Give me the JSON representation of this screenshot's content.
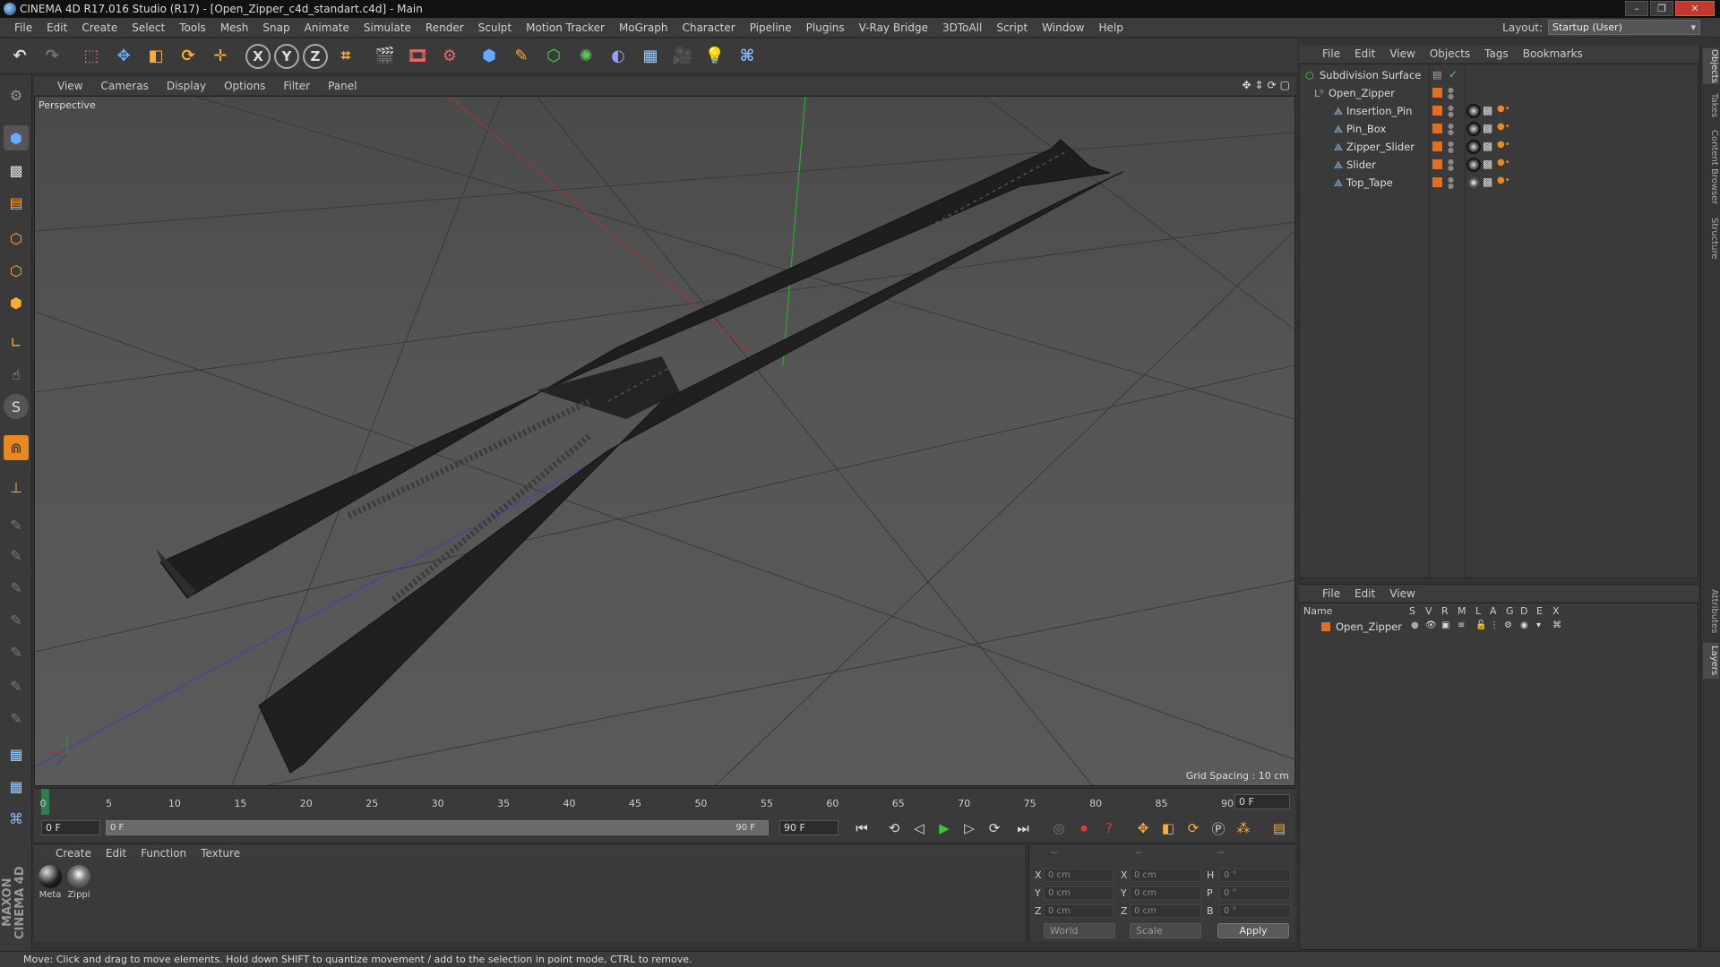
{
  "window": {
    "title": "CINEMA 4D R17.016 Studio (R17) - [Open_Zipper_c4d_standart.c4d] - Main"
  },
  "menu": [
    "File",
    "Edit",
    "Create",
    "Select",
    "Tools",
    "Mesh",
    "Snap",
    "Animate",
    "Simulate",
    "Render",
    "Sculpt",
    "Motion Tracker",
    "MoGraph",
    "Character",
    "Pipeline",
    "Plugins",
    "V-Ray Bridge",
    "3DToAll",
    "Script",
    "Window",
    "Help"
  ],
  "layout": {
    "label": "Layout:",
    "value": "Startup (User)"
  },
  "viewport": {
    "menu": [
      "View",
      "Cameras",
      "Display",
      "Options",
      "Filter",
      "Panel"
    ],
    "label": "Perspective",
    "grid_spacing": "Grid Spacing : 10 cm"
  },
  "timeline": {
    "ticks": [
      "0",
      "5",
      "10",
      "15",
      "20",
      "25",
      "30",
      "35",
      "40",
      "45",
      "50",
      "55",
      "60",
      "65",
      "70",
      "75",
      "80",
      "85",
      "90"
    ],
    "current_frame": "0 F"
  },
  "transport": {
    "start": "0 F",
    "range_start": "0 F",
    "range_end": "90 F",
    "end": "90 F"
  },
  "materials": {
    "menu": [
      "Create",
      "Edit",
      "Function",
      "Texture"
    ],
    "items": [
      {
        "label": "Meta"
      },
      {
        "label": "Zippi"
      }
    ]
  },
  "coords": {
    "headers": [
      "--",
      "--",
      "--"
    ],
    "rows": [
      {
        "a": "X",
        "av": "0 cm",
        "b": "X",
        "bv": "0 cm",
        "c": "H",
        "cv": "0 °"
      },
      {
        "a": "Y",
        "av": "0 cm",
        "b": "Y",
        "bv": "0 cm",
        "c": "P",
        "cv": "0 °"
      },
      {
        "a": "Z",
        "av": "0 cm",
        "b": "Z",
        "bv": "0 cm",
        "c": "B",
        "cv": "0 °"
      }
    ],
    "space": "World",
    "mode": "Scale",
    "apply": "Apply"
  },
  "status": "Move: Click and drag to move elements. Hold down SHIFT to quantize movement / add to the selection in point mode, CTRL to remove.",
  "maxon": "MAXON CINEMA 4D",
  "object_manager": {
    "menu": [
      "File",
      "Edit",
      "View",
      "Objects",
      "Tags",
      "Bookmarks"
    ],
    "objects": [
      {
        "name": "Subdivision Surface",
        "indent": 0,
        "type": "subdiv"
      },
      {
        "name": "Open_Zipper",
        "indent": 1,
        "type": "null"
      },
      {
        "name": "Insertion_Pin",
        "indent": 2,
        "type": "poly"
      },
      {
        "name": "Pin_Box",
        "indent": 2,
        "type": "poly"
      },
      {
        "name": "Zipper_Slider",
        "indent": 2,
        "type": "poly"
      },
      {
        "name": "Slider",
        "indent": 2,
        "type": "poly"
      },
      {
        "name": "Top_Tape",
        "indent": 2,
        "type": "poly"
      }
    ]
  },
  "layer_manager": {
    "menu": [
      "File",
      "Edit",
      "View"
    ],
    "columns": [
      "Name",
      "S",
      "V",
      "R",
      "M",
      "L",
      "A",
      "G",
      "D",
      "E",
      "X"
    ],
    "layers": [
      {
        "name": "Open_Zipper"
      }
    ]
  },
  "right_tabs": [
    "Objects",
    "Takes",
    "Content Browser",
    "Structure",
    "Attributes",
    "Layers"
  ],
  "colors": {
    "accent_orange": "#e07020",
    "axis_x": "#b03030",
    "axis_y": "#30a030",
    "axis_z": "#3040b0"
  }
}
